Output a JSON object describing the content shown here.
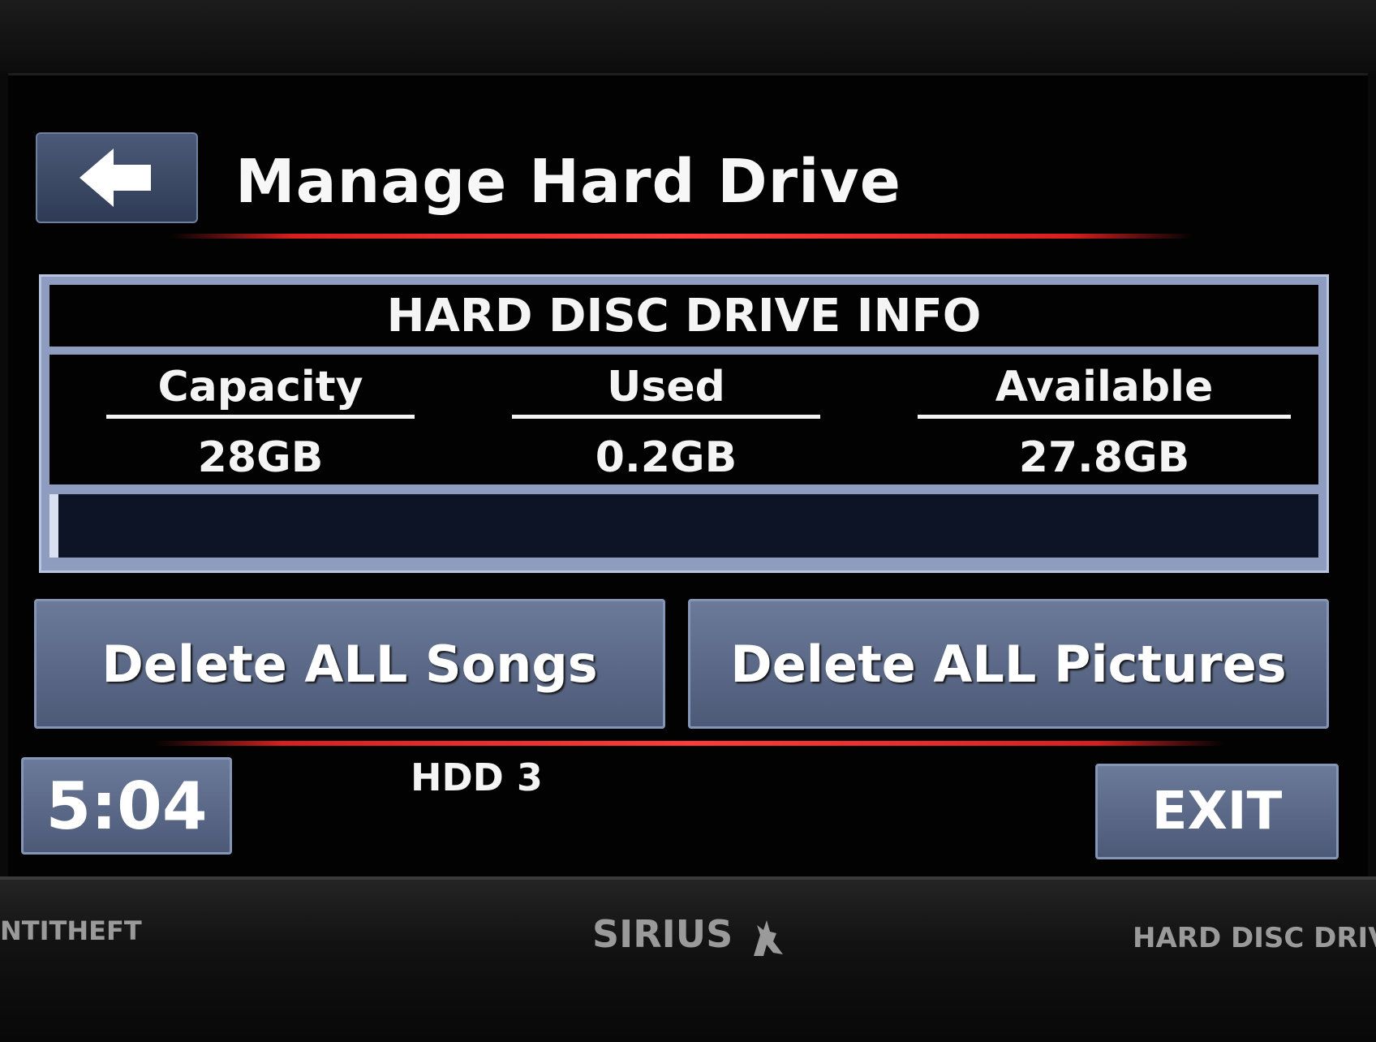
{
  "header": {
    "title": "Manage Hard Drive",
    "back_icon": "back-arrow-icon"
  },
  "hdd_info": {
    "heading": "HARD DISC DRIVE INFO",
    "columns": [
      {
        "label": "Capacity",
        "value": "28GB"
      },
      {
        "label": "Used",
        "value": "0.2GB"
      },
      {
        "label": "Available",
        "value": "27.8GB"
      }
    ],
    "usage_fraction": 0.007
  },
  "actions": {
    "delete_songs": "Delete ALL Songs",
    "delete_pictures": "Delete ALL Pictures"
  },
  "footer": {
    "clock": "5:04",
    "source": "HDD 3",
    "exit": "EXIT"
  },
  "bezel": {
    "left_text": "NTITHEFT",
    "brand": "SIRIUS",
    "brand_icon": "sirius-dog-icon",
    "right_text": "HARD DISC DRIVE"
  },
  "colors": {
    "accent_red": "#ff3b3b",
    "button_blue": "#5a6886",
    "panel_blue": "#8e9cc0"
  }
}
